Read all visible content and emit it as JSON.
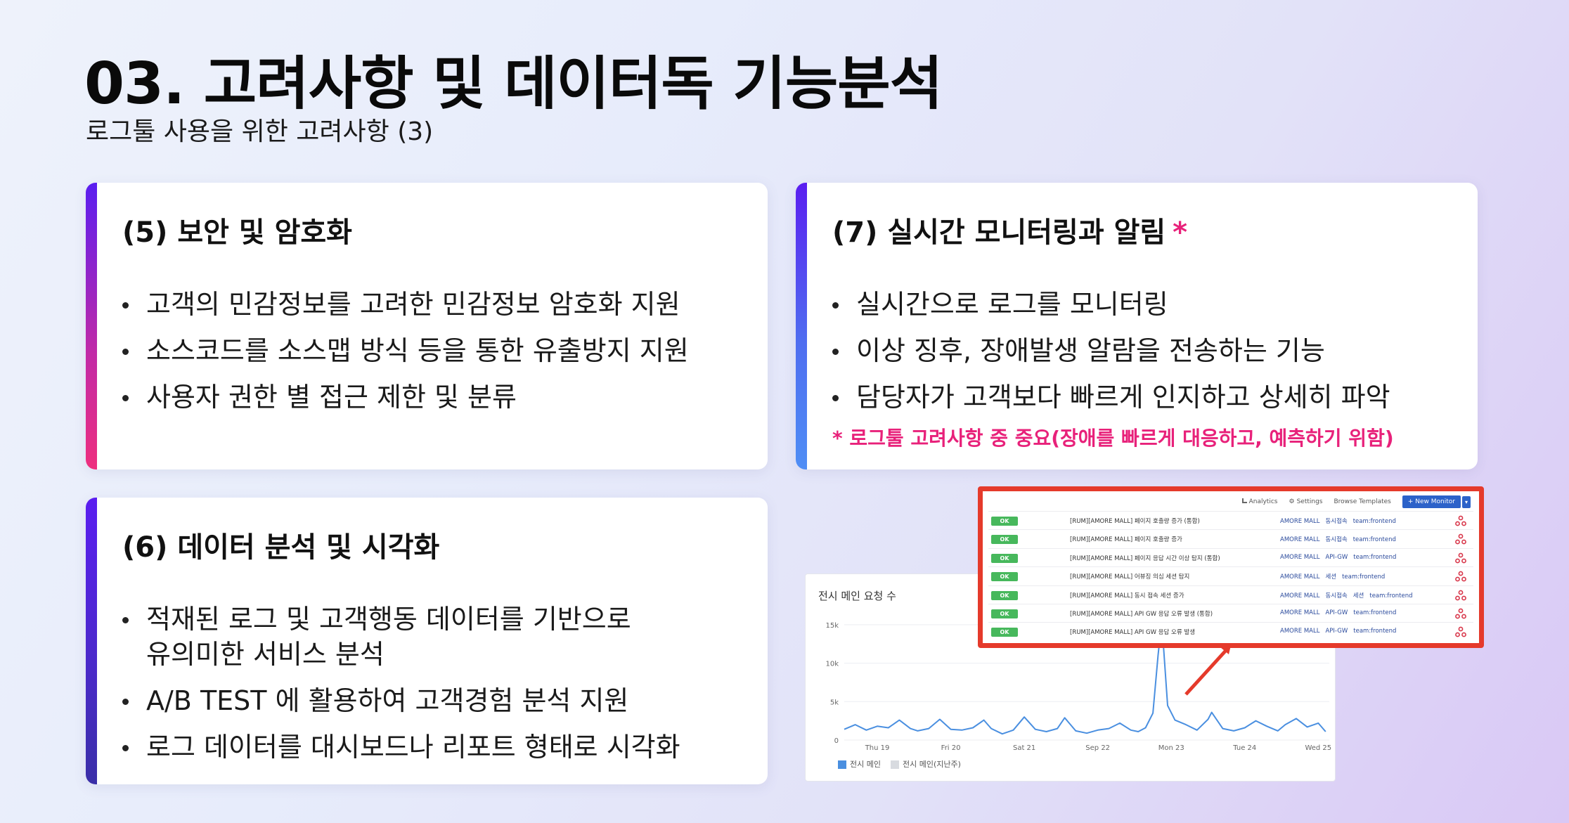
{
  "header": {
    "title": "03. 고려사항 및 데이터독 기능분석",
    "subtitle": "로그툴 사용을 위한 고려사항 (3)"
  },
  "cards": [
    {
      "title": "(5) 보안 및 암호화",
      "items": [
        "고객의 민감정보를 고려한 민감정보 암호화 지원",
        "소스코드를 소스맵 방식 등을 통한 유출방지 지원",
        "사용자 권한 별 접근 제한 및 분류"
      ]
    },
    {
      "title": "(7) 실시간 모니터링과 알림",
      "star": "*",
      "items": [
        "실시간으로 로그를 모니터링",
        "이상 징후, 장애발생 알람을 전송하는 기능",
        "담당자가 고객보다 빠르게 인지하고 상세히 파악"
      ],
      "note": "* 로그툴 고려사항 중 중요(장애를 빠르게 대응하고, 예측하기 위함)"
    },
    {
      "title": "(6) 데이터 분석 및 시각화",
      "items": [
        "적재된 로그 및 고객행동 데이터를 기반으로",
        "유의미한 서비스 분석",
        "A/B TEST 에 활용하여 고객경험 분석 지원",
        "로그 데이터를 대시보드나 리포트 형태로 시각화"
      ]
    }
  ],
  "colors": {
    "accent_pink": "#e8217a",
    "bar_purple": "#5a1ef0",
    "chart_line": "#4a8fe0",
    "highlight_red": "#e53a2b",
    "status_ok": "#47b85c",
    "button_blue": "#2c62c9"
  },
  "monitor": {
    "toolbar": {
      "analytics": "Analytics",
      "settings": "Settings",
      "browse": "Browse Templates",
      "new_monitor": "+ New Monitor",
      "caret": "▾"
    },
    "rows": [
      {
        "status": "OK",
        "name": "[RUM][AMORE MALL] 페이지 호출량 증가 (통합)",
        "tags": [
          "AMORE MALL",
          "동시접속",
          "team:frontend"
        ]
      },
      {
        "status": "OK",
        "name": "[RUM][AMORE MALL] 페이지 호출량 증가",
        "tags": [
          "AMORE MALL",
          "동시접속",
          "team:frontend"
        ]
      },
      {
        "status": "OK",
        "name": "[RUM][AMORE MALL] 페이지 응답 시간 이상 탐지 (통합)",
        "tags": [
          "AMORE MALL",
          "API-GW",
          "team:frontend"
        ]
      },
      {
        "status": "OK",
        "name": "[RUM][AMORE MALL] 어뷰징 의심 세션 탐지",
        "tags": [
          "AMORE MALL",
          "세션",
          "team:frontend"
        ]
      },
      {
        "status": "OK",
        "name": "[RUM][AMORE MALL] 동시 접속 세션 증가",
        "tags": [
          "AMORE MALL",
          "동시접속",
          "세션",
          "team:frontend"
        ]
      },
      {
        "status": "OK",
        "name": "[RUM][AMORE MALL] API GW 응답 오류 발생 (통합)",
        "tags": [
          "AMORE MALL",
          "API-GW",
          "team:frontend"
        ]
      },
      {
        "status": "OK",
        "name": "[RUM][AMORE MALL] API GW 응답 오류 발생",
        "tags": [
          "AMORE MALL",
          "API-GW",
          "team:frontend"
        ]
      }
    ]
  },
  "chart_data": {
    "type": "line",
    "title": "전시 메인 요청 수",
    "xlabel": "",
    "ylabel": "",
    "ylim": [
      0,
      17000
    ],
    "yticks": [
      "0",
      "5k",
      "10k",
      "15k"
    ],
    "ytick_values": [
      0,
      5000,
      10000,
      15000
    ],
    "xticks": [
      "Thu 19",
      "Fri 20",
      "Sat 21",
      "Sep 22",
      "Mon 23",
      "Tue 24",
      "Wed 25"
    ],
    "xlim": [
      0,
      6.6
    ],
    "legend_position": "bottom-left",
    "series": [
      {
        "name": "전시 메인",
        "color": "#4a8fe0",
        "x": [
          0,
          0.15,
          0.3,
          0.45,
          0.6,
          0.75,
          0.9,
          1.0,
          1.15,
          1.3,
          1.45,
          1.6,
          1.75,
          1.9,
          2.0,
          2.15,
          2.3,
          2.45,
          2.6,
          2.75,
          2.9,
          3.0,
          3.15,
          3.3,
          3.45,
          3.6,
          3.75,
          3.9,
          4.0,
          4.1,
          4.2,
          4.27,
          4.32,
          4.4,
          4.5,
          4.65,
          4.8,
          4.95,
          5.0,
          5.15,
          5.3,
          5.45,
          5.6,
          5.75,
          5.9,
          6.0,
          6.15,
          6.3,
          6.45,
          6.55
        ],
        "values": [
          1400,
          2000,
          1300,
          1800,
          1600,
          2600,
          1500,
          1200,
          1500,
          2700,
          1400,
          1300,
          1600,
          2600,
          1500,
          800,
          1300,
          3000,
          1400,
          1100,
          1500,
          2900,
          1200,
          900,
          1300,
          1500,
          2200,
          1300,
          1100,
          1600,
          3500,
          11000,
          15500,
          4500,
          2600,
          2000,
          1300,
          2700,
          3600,
          1500,
          1200,
          1600,
          2500,
          1800,
          1200,
          2000,
          2800,
          1700,
          2200,
          1100
        ]
      },
      {
        "name": "전시 메인(지난주)",
        "color": "#cfd3d8",
        "values": []
      }
    ]
  }
}
